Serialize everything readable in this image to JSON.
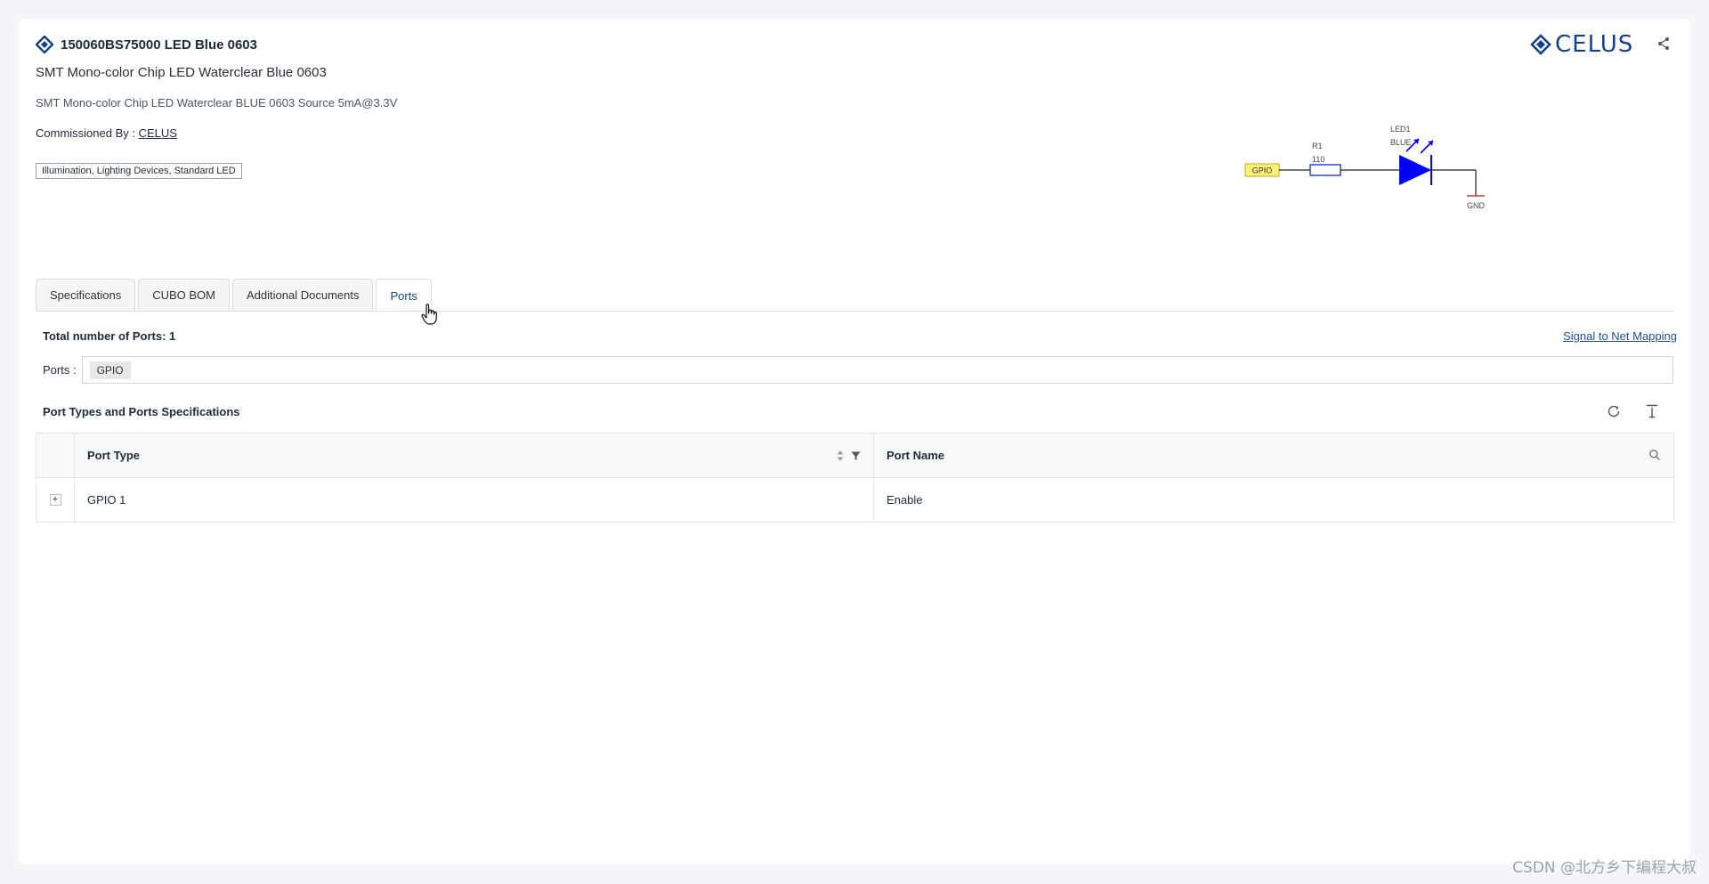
{
  "header": {
    "title": "150060BS75000 LED Blue 0603",
    "subtitle": "SMT Mono-color Chip LED Waterclear Blue 0603",
    "description": "SMT Mono-color Chip LED Waterclear BLUE 0603 Source 5mA@3.3V",
    "commissioned_label": "Commissioned By :",
    "commissioned_value": "CELUS",
    "tag": "Illumination, Lighting Devices, Standard LED",
    "brand": "CELUS"
  },
  "schematic": {
    "gpio": "GPIO",
    "r_ref": "R1",
    "r_val": "110",
    "led_ref": "LED1",
    "led_val": "BLUE",
    "gnd": "GND"
  },
  "tabs": [
    {
      "label": "Specifications"
    },
    {
      "label": "CUBO BOM"
    },
    {
      "label": "Additional Documents"
    },
    {
      "label": "Ports",
      "active": true
    }
  ],
  "ports": {
    "total_label": "Total number of Ports: 1",
    "signal_link": "Signal to Net Mapping",
    "ports_label": "Ports :",
    "chips": [
      "GPIO"
    ]
  },
  "spec_table": {
    "title": "Port Types and Ports Specifications",
    "columns": [
      "Port Type",
      "Port Name"
    ],
    "rows": [
      {
        "expand": "+",
        "port_type": "GPIO 1",
        "port_name": "Enable"
      }
    ]
  },
  "colors": {
    "brand": "#12428f",
    "link": "#1f4f9a",
    "led": "#0000ff",
    "gpio_fill": "#fff27a"
  },
  "watermark": "CSDN @北方乡下编程大叔"
}
